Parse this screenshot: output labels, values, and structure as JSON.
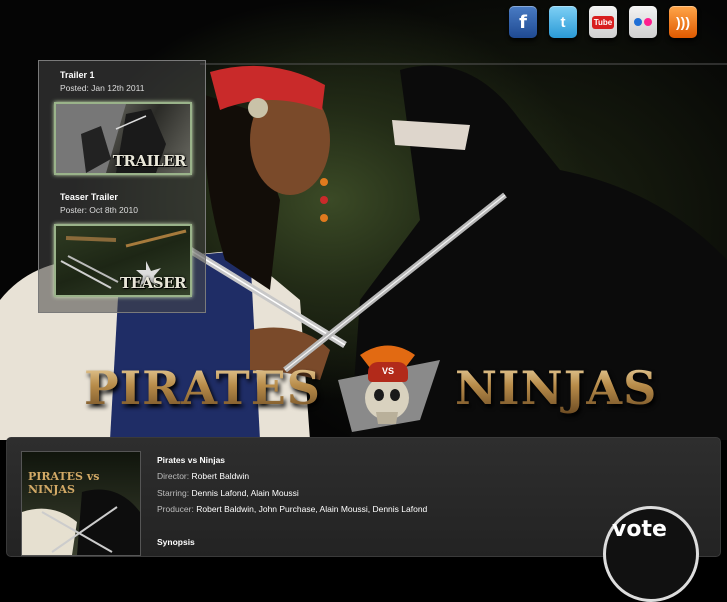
{
  "social": {
    "facebook_glyph": "f",
    "twitter_glyph": "t",
    "youtube_glyph": "Tube",
    "rss_glyph": ")))"
  },
  "trailers": [
    {
      "title": "Trailer 1",
      "date": "Posted: Jan 12th 2011",
      "thumb_label": "TRAILER"
    },
    {
      "title": "Teaser Trailer",
      "date": "Poster: Oct 8th 2010",
      "thumb_label": "TEASER"
    }
  ],
  "logo": {
    "left": "PIRATES",
    "vs": "VS",
    "right": "NINJAS"
  },
  "info": {
    "poster_title": "PIRATES vs NINJAS",
    "title": "Pirates vs Ninjas",
    "director_label": "Director:",
    "director": "Robert Baldwin",
    "starring_label": "Starring:",
    "starring": "Dennis Lafond, Alain Moussi",
    "producer_label": "Producer:",
    "producer": "Robert Baldwin, John Purchase, Alain Moussi, Dennis Lafond",
    "synopsis_label": "Synopsis",
    "vote_label": "vote"
  },
  "colors": {
    "background": "#000000",
    "panel": "#2b2b2b",
    "logo_gold": "#b9945a",
    "thumb_border": "#9ab38a"
  }
}
